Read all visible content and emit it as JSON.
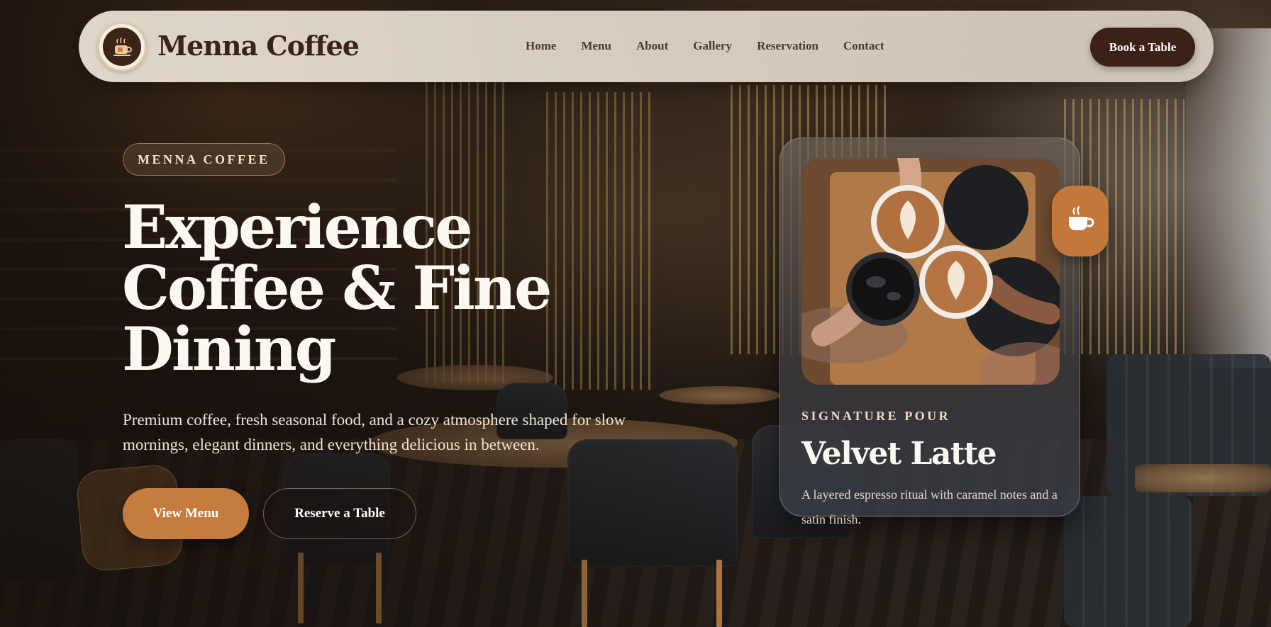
{
  "header": {
    "brand": "Menna Coffee",
    "logo_icon": "coffee-cup-icon",
    "nav": [
      {
        "label": "Home"
      },
      {
        "label": "Menu"
      },
      {
        "label": "About"
      },
      {
        "label": "Gallery"
      },
      {
        "label": "Reservation"
      },
      {
        "label": "Contact"
      }
    ],
    "cta_label": "Book a Table"
  },
  "hero": {
    "eyebrow": "MENNA COFFEE",
    "headline_line1": "Experience",
    "headline_line2": "Coffee & Fine",
    "headline_line3": "Dining",
    "subtext": "Premium coffee, fresh seasonal food, and a cozy atmosphere shaped for slow mornings, elegant dinners, and everything delicious in between.",
    "primary_button": "View Menu",
    "secondary_button": "Reserve a Table"
  },
  "card": {
    "eyebrow": "SIGNATURE POUR",
    "title": "Velvet Latte",
    "description": "A layered espresso ritual with caramel notes and a satin finish.",
    "photo_alt": "latte-art-cups-photo",
    "badge_icon": "coffee-cup-icon"
  },
  "colors": {
    "accent": "#c47c3f",
    "dark_brown": "#3b2117",
    "header_bg": "#e4dacb",
    "text_light": "#fbf7f1"
  }
}
